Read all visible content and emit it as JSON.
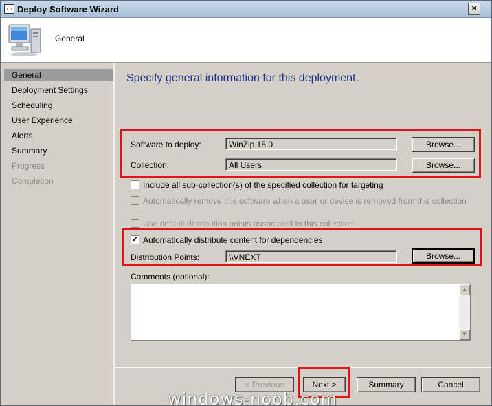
{
  "window": {
    "title": "Deploy Software Wizard",
    "close_glyph": "✕"
  },
  "header": {
    "title": "General"
  },
  "nav": {
    "items": [
      {
        "label": "General"
      },
      {
        "label": "Deployment Settings"
      },
      {
        "label": "Scheduling"
      },
      {
        "label": "User Experience"
      },
      {
        "label": "Alerts"
      },
      {
        "label": "Summary"
      },
      {
        "label": "Progress"
      },
      {
        "label": "Completion"
      }
    ]
  },
  "main": {
    "heading": "Specify general information for this deployment.",
    "software_label": "Software to deploy:",
    "software_value": "WinZip 15.0",
    "collection_label": "Collection:",
    "collection_value": "All Users",
    "browse_label": "Browse...",
    "include_subcollections": "Include all sub-collection(s) of the specified collection for targeting",
    "auto_remove": "Automatically remove this software when a user or device is removed from this collection",
    "use_default_dp": "Use default distribution points associated to this collection",
    "auto_distribute": "Automatically distribute content for dependencies",
    "dp_label": "Distribution Points:",
    "dp_value": "\\\\VNEXT",
    "comments_label": "Comments (optional):",
    "checked_glyph": "✔"
  },
  "footer": {
    "previous": "< Previous",
    "next": "Next >",
    "summary": "Summary",
    "cancel": "Cancel"
  },
  "watermark": "windows-noob.com",
  "colors": {
    "highlight": "#e0141c",
    "heading": "#1f2f85"
  }
}
